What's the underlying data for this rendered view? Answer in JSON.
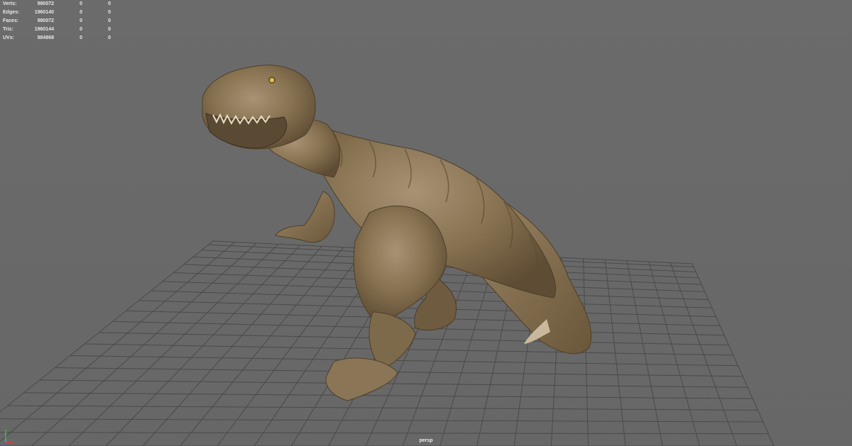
{
  "viewport": {
    "camera": "persp",
    "background_color": "#6a6a6a",
    "grid_color": "#4a4a4a"
  },
  "hud": {
    "rows": [
      {
        "label": "Verts:",
        "values": [
          "980072",
          "0",
          "0"
        ]
      },
      {
        "label": "Edges:",
        "values": [
          "1960140",
          "0",
          "0"
        ]
      },
      {
        "label": "Faces:",
        "values": [
          "980072",
          "0",
          "0"
        ]
      },
      {
        "label": "Tris:",
        "values": [
          "1960144",
          "0",
          "0"
        ]
      },
      {
        "label": "UVs:",
        "values": [
          "984868",
          "0",
          "0"
        ]
      }
    ]
  },
  "model": {
    "icon": "trex-model",
    "skin_color": "#8a7457"
  },
  "axis_gizmo": {
    "icon": "axis-gizmo-icon"
  }
}
